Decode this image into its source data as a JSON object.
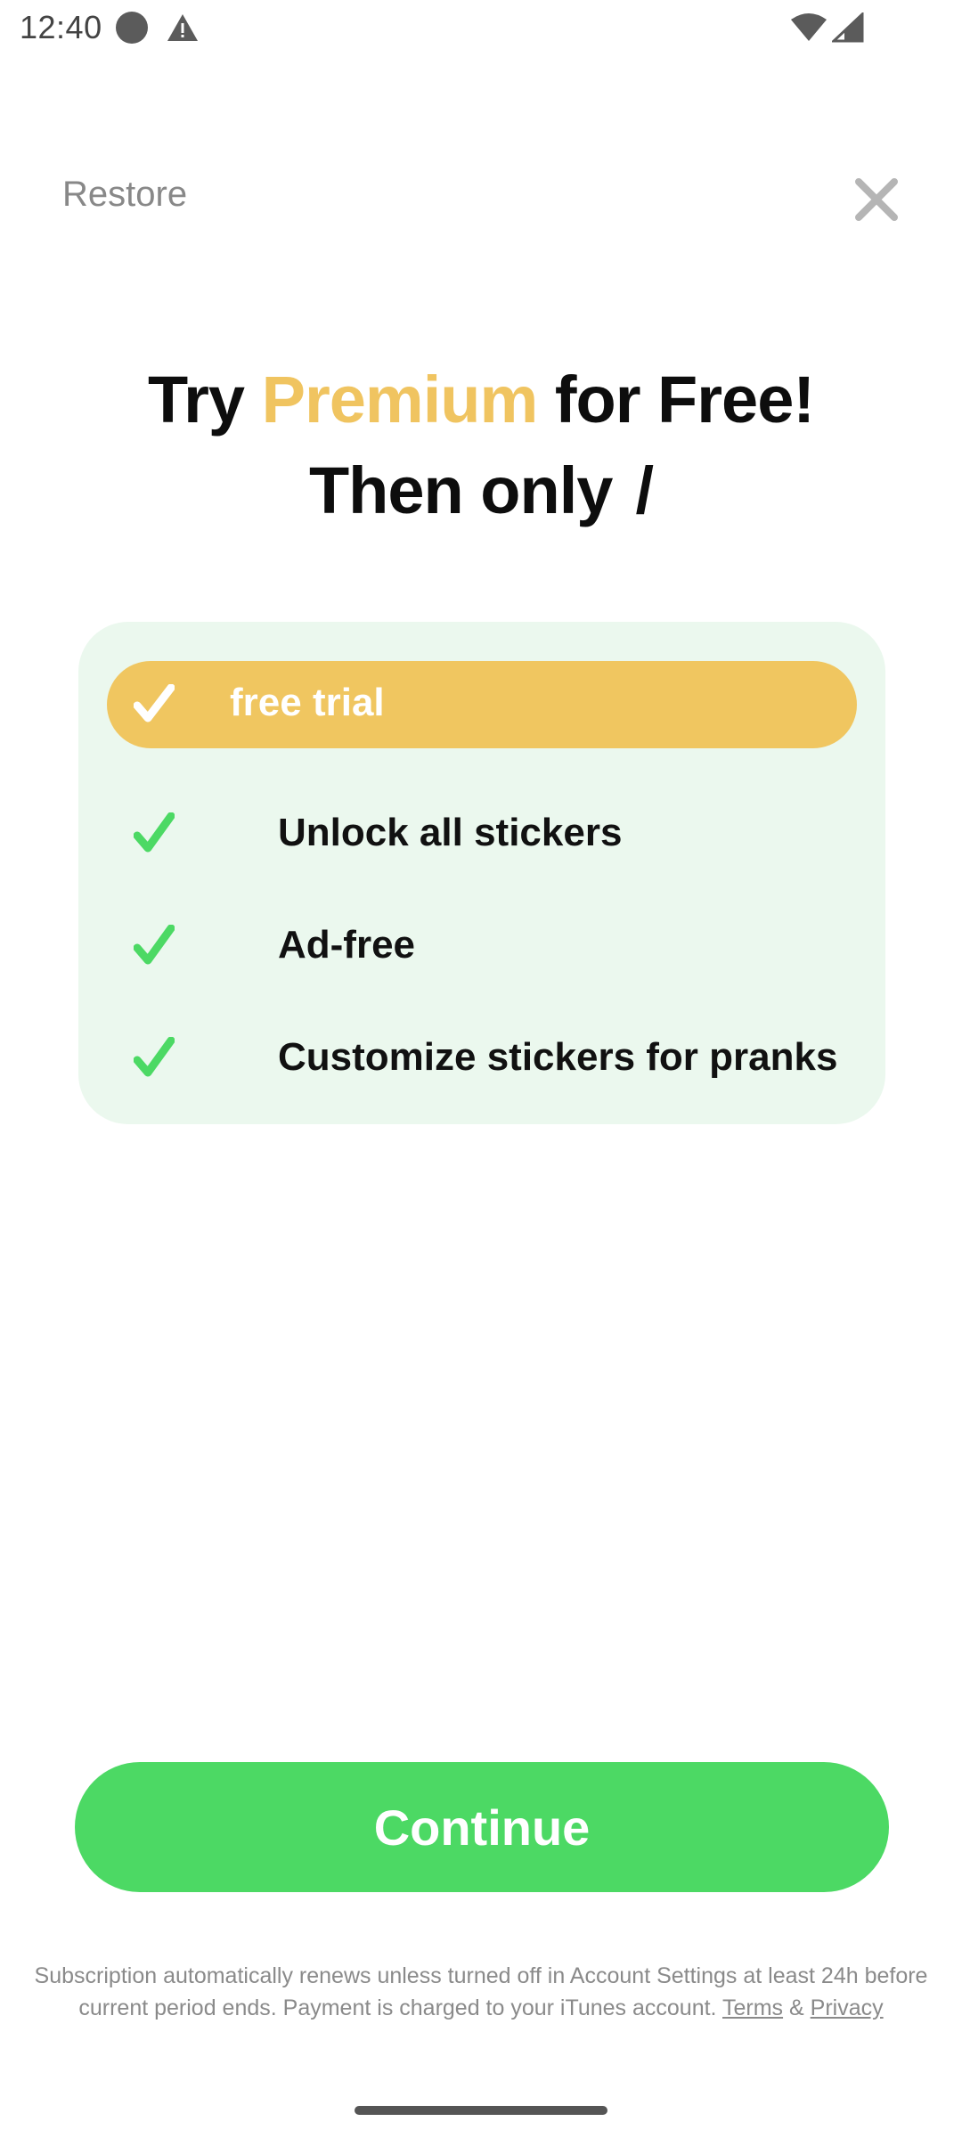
{
  "status_bar": {
    "time": "12:40"
  },
  "header": {
    "restore_label": "Restore",
    "close_icon": "close-icon"
  },
  "headline": {
    "prefix": "Try ",
    "accent": "Premium",
    "suffix": " for Free!",
    "line2": "Then only",
    "price_slash": "/"
  },
  "card": {
    "trial_label": "free trial",
    "features": [
      "Unlock all stickers",
      "Ad-free",
      "Customize stickers for pranks"
    ]
  },
  "cta": {
    "continue_label": "Continue"
  },
  "legal": {
    "text_line1": "Subscription automatically renews unless turned off in Account Settings at least 24h before",
    "text_line2": "current period ends. Payment is charged to your iTunes account.",
    "terms_label": "Terms",
    "ampersand": "&",
    "privacy_label": "Privacy"
  },
  "colors": {
    "accent_yellow": "#f0c460",
    "cta_green": "#4cd964",
    "card_background": "#ebf8ee"
  }
}
